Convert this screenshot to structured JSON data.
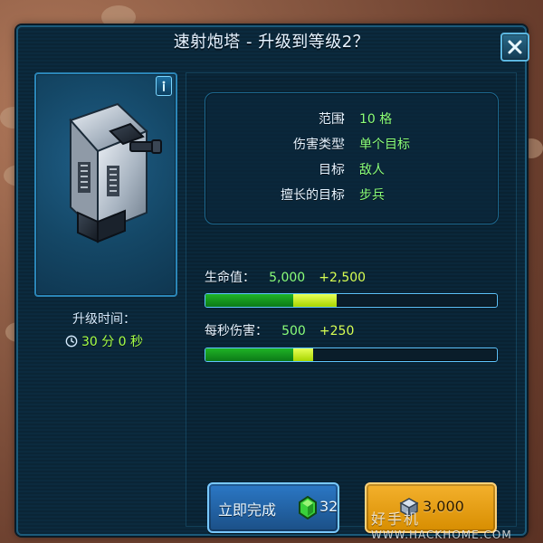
{
  "dialog": {
    "title": "速射炮塔 - 升级到等级2？",
    "close_icon": "close-icon"
  },
  "left": {
    "upgrade_time_label": "升级时间：",
    "upgrade_time_value": "30 分 0 秒",
    "clock_icon": "clock-icon",
    "info_icon": "info-icon"
  },
  "attributes": [
    {
      "label": "范围",
      "value": "10 格"
    },
    {
      "label": "伤害类型",
      "value": "单个目标"
    },
    {
      "label": "目标",
      "value": "敌人"
    },
    {
      "label": "擅长的目标",
      "value": "步兵"
    }
  ],
  "stats": [
    {
      "label": "生命值：",
      "base": "5,000",
      "increase": "+2,500",
      "base_fraction": 0.3,
      "increase_fraction": 0.15
    },
    {
      "label": "每秒伤害：",
      "base": "500",
      "increase": "+250",
      "base_fraction": 0.3,
      "increase_fraction": 0.07
    }
  ],
  "buttons": {
    "finish_now": {
      "label": "立即完成",
      "cost": "32",
      "icon": "gem-icon"
    },
    "upgrade": {
      "cost": "3,000",
      "icon": "metal-icon"
    }
  },
  "watermark": {
    "cn": "好手机",
    "url": "WWW.HACKHOME.COM"
  },
  "colors": {
    "panel_bg": "#0b2a3e",
    "accent_blue": "#2b86b8",
    "green_text": "#8bff7a",
    "yellow_text": "#d8ff53",
    "orange_button": "#f4b12d"
  }
}
